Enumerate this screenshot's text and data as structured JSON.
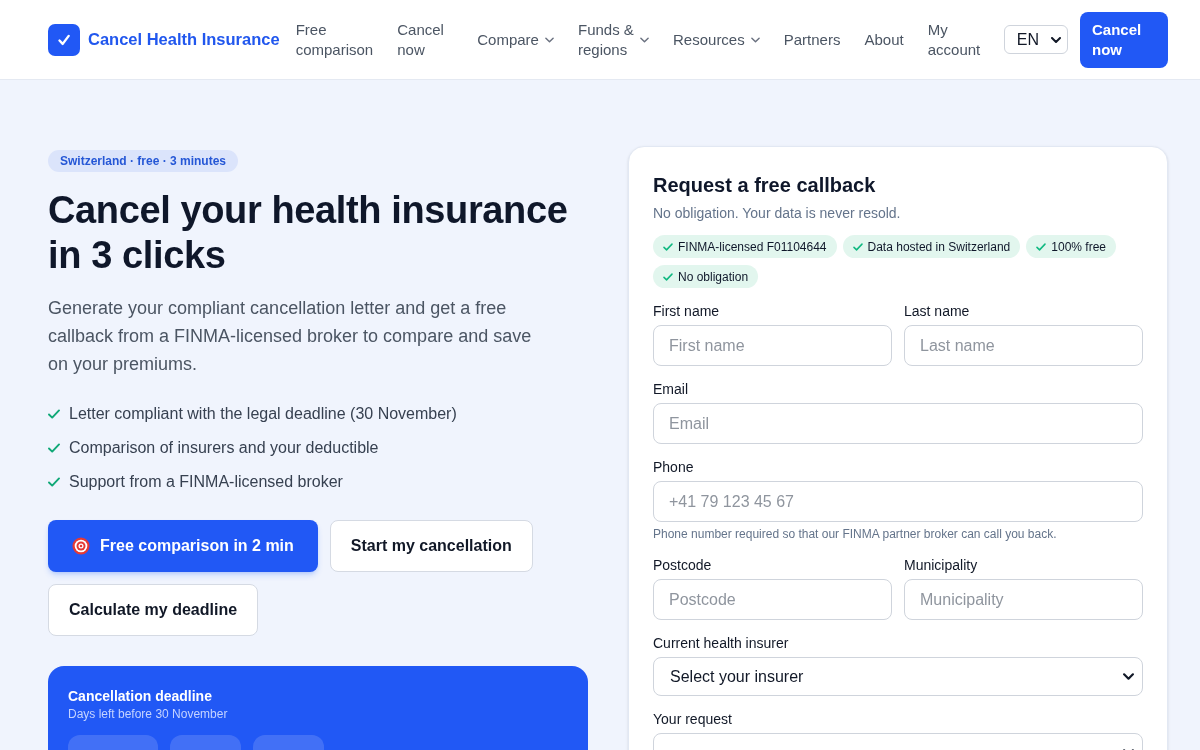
{
  "header": {
    "brand": "Cancel Health Insurance",
    "nav": [
      {
        "label": "Free comparison",
        "dropdown": false
      },
      {
        "label": "Cancel now",
        "dropdown": false
      },
      {
        "label": "Compare",
        "dropdown": true
      },
      {
        "label": "Funds & regions",
        "dropdown": true
      },
      {
        "label": "Resources",
        "dropdown": true
      },
      {
        "label": "Partners",
        "dropdown": false
      },
      {
        "label": "About",
        "dropdown": false
      },
      {
        "label": "My account",
        "dropdown": false
      }
    ],
    "language": "EN",
    "cta": "Cancel now"
  },
  "hero": {
    "badge": "Switzerland · free · 3 minutes",
    "title": "Cancel your health insurance in 3 clicks",
    "lead": "Generate your compliant cancellation letter and get a free callback from a FINMA-licensed broker to compare and save on your premiums.",
    "benefits": [
      "Letter compliant with the legal deadline (30 November)",
      "Comparison of insurers and your deductible",
      "Support from a FINMA-licensed broker"
    ],
    "buttons": [
      {
        "label": "Free comparison in 2 min",
        "kind": "primary"
      },
      {
        "label": "Start my cancellation",
        "kind": "secondary"
      },
      {
        "label": "Calculate my deadline",
        "kind": "secondary"
      }
    ]
  },
  "deadline_card": {
    "title": "Cancellation deadline",
    "subtitle": "Days left before 30 November"
  },
  "callback_form": {
    "title": "Request a free callback",
    "subtitle": "No obligation. Your data is never resold.",
    "trust_badges": [
      "FINMA-licensed F01104644",
      "Data hosted in Switzerland",
      "100% free",
      "No obligation"
    ],
    "rows": [
      [
        {
          "kind": "input",
          "label": "First name",
          "placeholder": "First name"
        },
        {
          "kind": "input",
          "label": "Last name",
          "placeholder": "Last name"
        }
      ],
      [
        {
          "kind": "input",
          "label": "Email",
          "placeholder": "Email"
        }
      ],
      [
        {
          "kind": "input",
          "label": "Phone",
          "placeholder": "+41 79 123 45 67",
          "hint": "Phone number required so that our FINMA partner broker can call you back."
        }
      ],
      [
        {
          "kind": "input",
          "label": "Postcode",
          "placeholder": "Postcode"
        },
        {
          "kind": "input",
          "label": "Municipality",
          "placeholder": "Municipality"
        }
      ],
      [
        {
          "kind": "select",
          "label": "Current health insurer",
          "value": "Select your insurer"
        }
      ],
      [
        {
          "kind": "select",
          "label": "Your request"
        }
      ]
    ]
  }
}
